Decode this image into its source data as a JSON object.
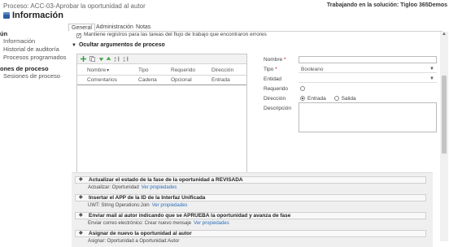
{
  "header": {
    "process_name": "Proceso: ACC-03-Aprobar la oportunidad al autor",
    "solution_text": "Trabajando en la solución: Tigloo 365Demos",
    "page_title": "Información"
  },
  "sidebar": {
    "general_heading": "ún",
    "general_items": [
      "Información",
      "Historial de auditoría",
      "Procesos programados"
    ],
    "process_heading": "ones de proceso",
    "process_items": [
      "Sesiones de proceso"
    ]
  },
  "tabs": [
    "General",
    "Administración",
    "Notas"
  ],
  "form": {
    "keep_records_label": "Mantiene registros para las tareas del flujo de trabajo que encontraron errores",
    "section_title": "Ocultar argumentos de proceso",
    "toolbar_icons": [
      "add-icon",
      "copy-icon",
      "move-down-icon",
      "move-up-icon",
      "sort-ascending-icon",
      "sort-descending-icon"
    ],
    "arguments_table": {
      "columns": [
        "Nombre",
        "Tipo",
        "Requerido",
        "Dirección"
      ],
      "rows": [
        [
          "Comentarios",
          "Cadena",
          "Opcional",
          "Entrada"
        ]
      ]
    },
    "properties": {
      "nombre_label": "Nombre",
      "nombre_value": "",
      "tipo_label": "Tipo",
      "tipo_value": "Booleano",
      "entidad_label": "Entidad",
      "entidad_value": "",
      "requerido_label": "Requerido",
      "direccion_label": "Dirección",
      "direccion_options": [
        "Entrada",
        "Salida"
      ],
      "direccion_selected": "Entrada",
      "descripcion_label": "Descripción"
    }
  },
  "steps": [
    {
      "title": "Actualizar el estado de la fase de la oportunidad a REVISADA",
      "detail": "Actualizar:  Oportunidad",
      "link": "Ver propiedades"
    },
    {
      "title": "Insertar el APP de la ID de la Interfaz Unificada",
      "detail": "UWT: String Operations:Join",
      "link": "Ver propiedades"
    },
    {
      "title": "Enviar mail al autor indicando que se APRUEBA la oportunidad y avanza de fase",
      "detail": "Enviar correo electrónico:  Crear nuevo mensaje",
      "link": "Ver propiedades"
    },
    {
      "title": "Asignar de nuevo la oportunidad al autor",
      "detail": "Asignar:  Oportunidad  a  Oportunidad:Autor",
      "link": ""
    }
  ],
  "colors": {
    "link": "#2a6ebb",
    "required_marker": "#cc0000",
    "toolbar_add": "#2e9e3a",
    "toolbar_move": "#4aa34a"
  }
}
